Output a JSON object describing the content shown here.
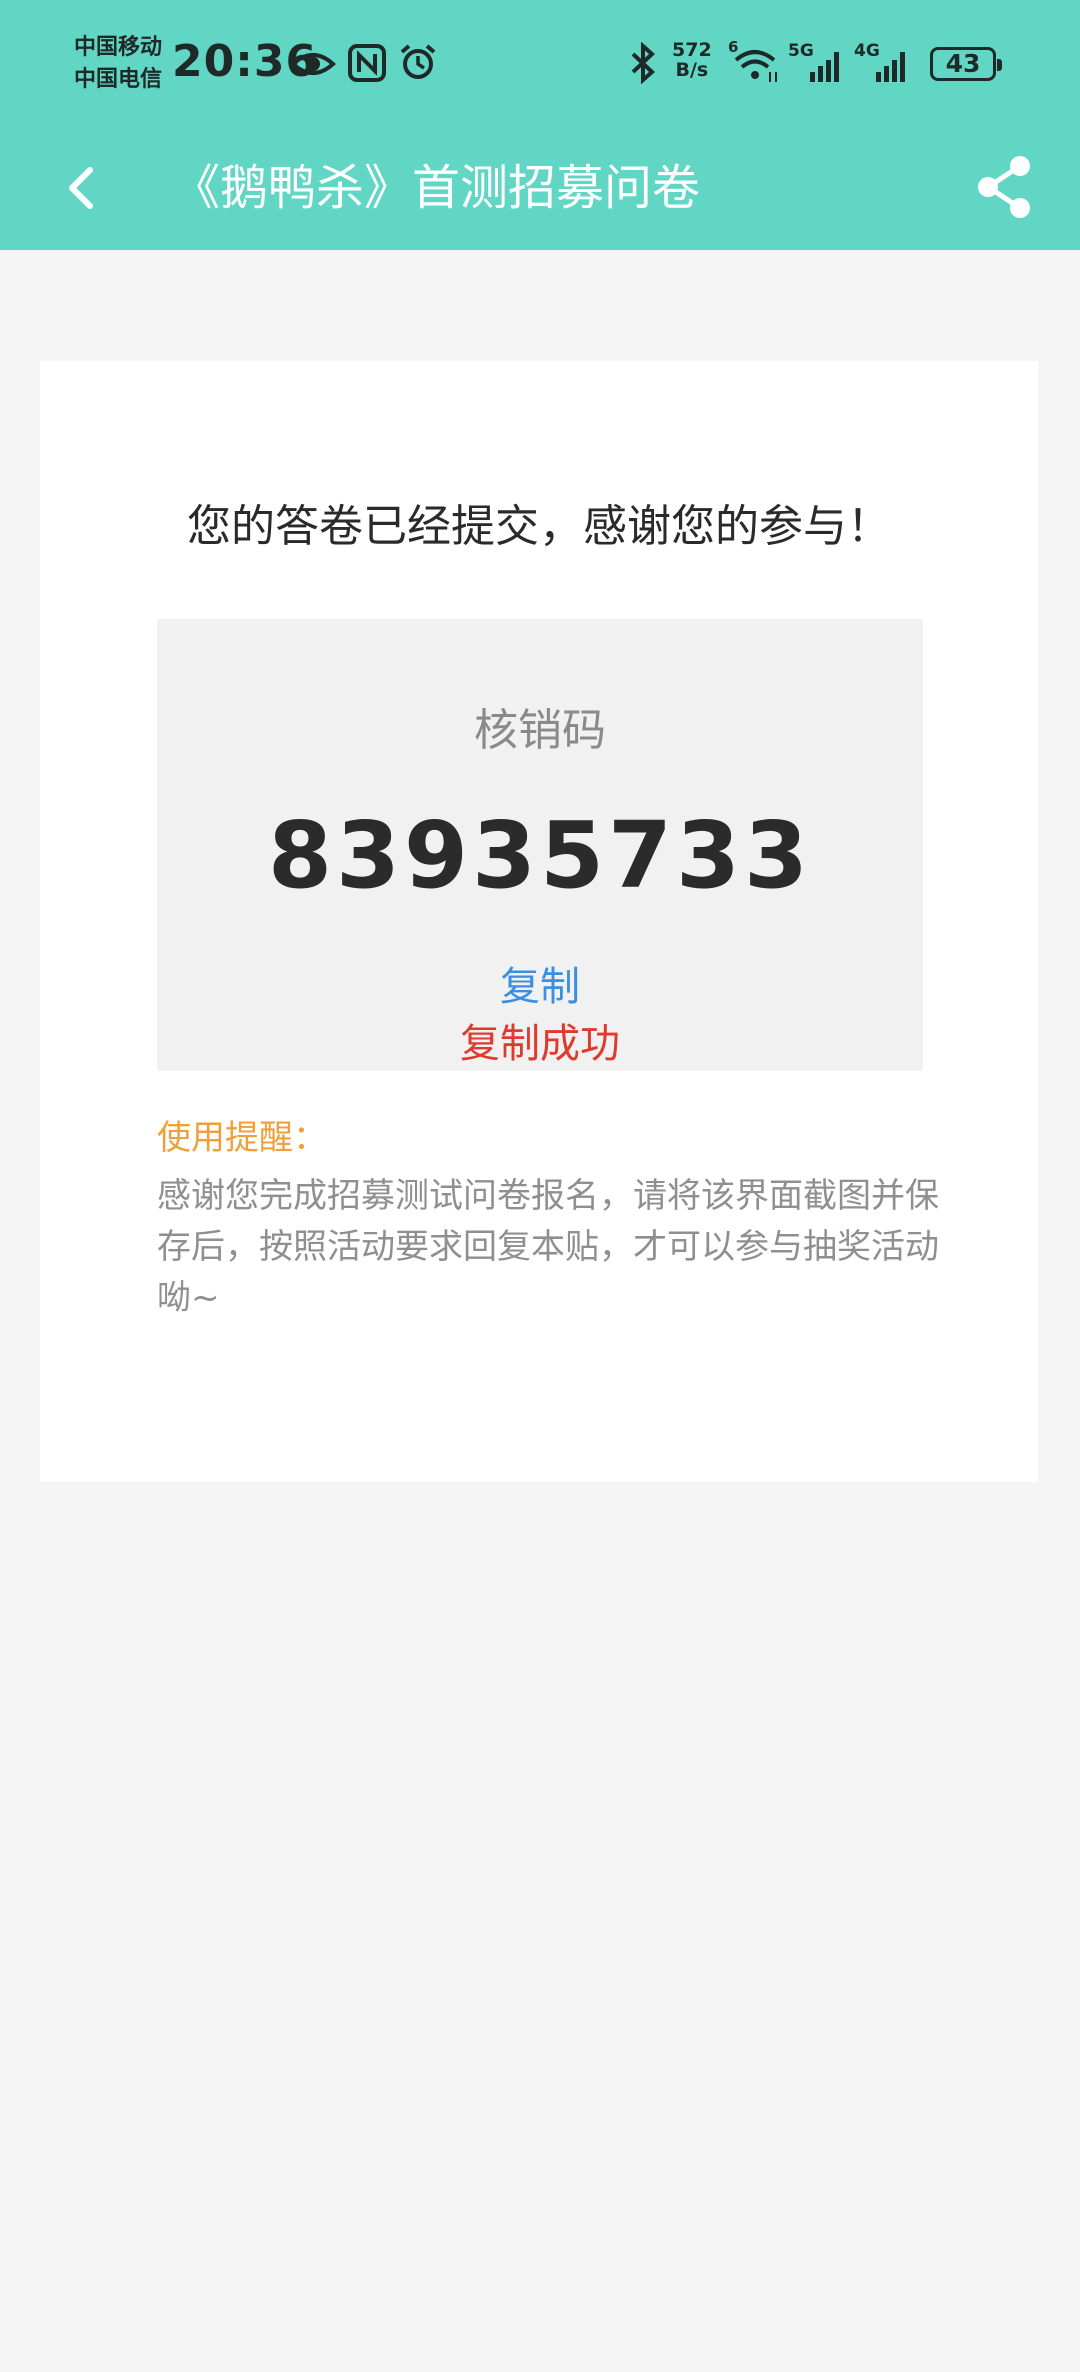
{
  "status_bar": {
    "carrier_1": "中国移动",
    "carrier_2": "中国电信",
    "time": "20:36",
    "net_speed_value": "572",
    "net_speed_unit": "B/s",
    "wifi_badge": "6",
    "signal_1_label": "5G",
    "signal_2_label": "4G",
    "battery": "43",
    "icons": [
      "eye-icon",
      "nfc-icon",
      "alarm-icon",
      "bluetooth-icon",
      "wifi-icon",
      "signal-icon"
    ]
  },
  "app_bar": {
    "title": "《鹅鸭杀》首测招募问卷",
    "back_icon": "chevron-left-icon",
    "share_icon": "share-icon",
    "background": "#62d6c4"
  },
  "result": {
    "message": "您的答卷已经提交，感谢您的参与！",
    "code_label": "核销码",
    "code_value": "83935733",
    "copy_label": "复制",
    "copy_success": "复制成功",
    "copy_color": "#3b8fe0",
    "success_color": "#e0392d"
  },
  "tips": {
    "title": "使用提醒：",
    "body": "感谢您完成招募测试问卷报名，请将该界面截图并保存后，按照活动要求回复本贴，才可以参与抽奖活动呦~",
    "title_color": "#f0a03a"
  }
}
